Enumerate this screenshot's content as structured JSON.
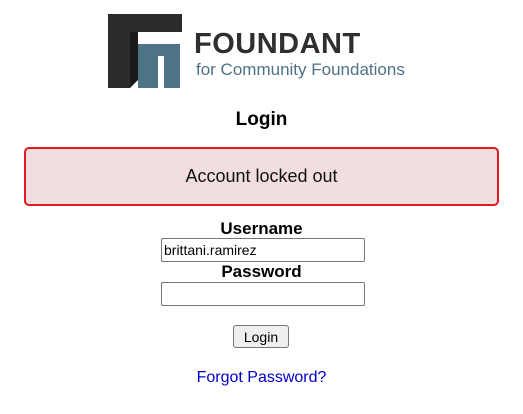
{
  "logo": {
    "title": "FOUNDANT",
    "subtitle": "for Community Foundations",
    "icon": "foundant-logo-icon",
    "colors": {
      "dark": "#2b2b2b",
      "blue": "#4e7286"
    }
  },
  "heading": "Login",
  "alert": {
    "message": "Account locked out",
    "border_color": "#e01b24",
    "background_color": "#f2dede"
  },
  "form": {
    "username_label": "Username",
    "username_value": "brittani.ramirez",
    "password_label": "Password",
    "password_value": "",
    "submit_label": "Login"
  },
  "forgot_password": {
    "label": "Forgot Password?"
  }
}
